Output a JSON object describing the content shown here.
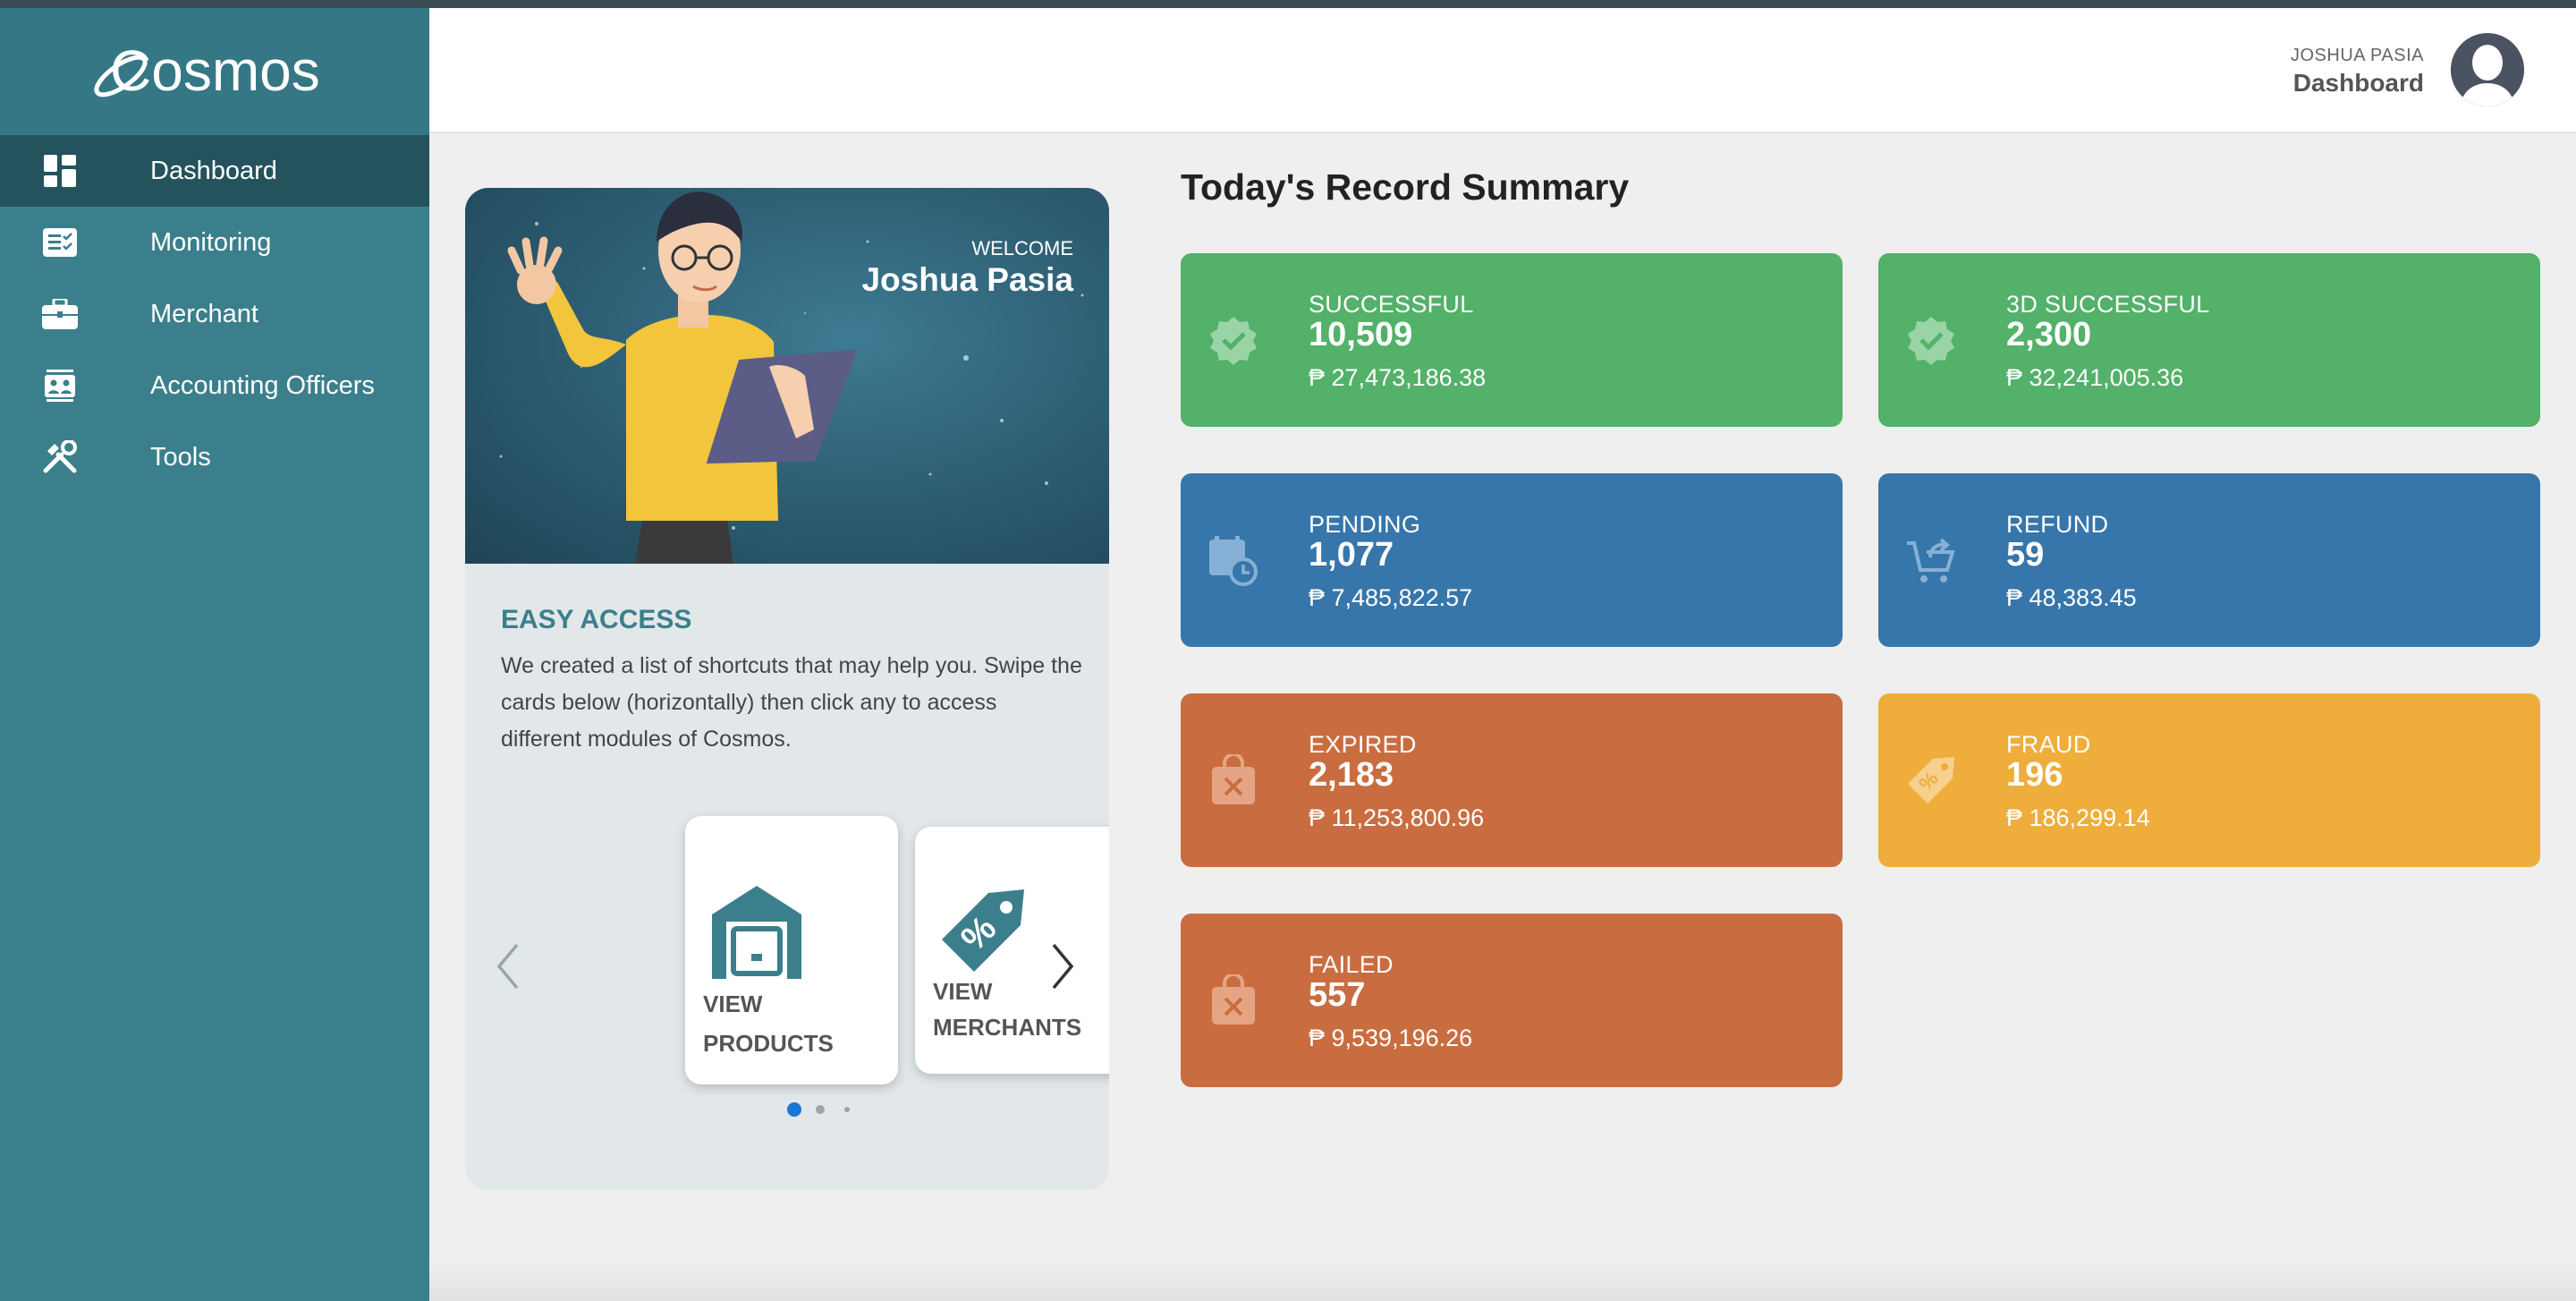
{
  "app": {
    "name": "Cosmos"
  },
  "sidebar": {
    "items": [
      {
        "label": "Dashboard",
        "icon": "dashboard-icon",
        "active": true
      },
      {
        "label": "Monitoring",
        "icon": "monitoring-icon",
        "active": false
      },
      {
        "label": "Merchant",
        "icon": "briefcase-icon",
        "active": false
      },
      {
        "label": "Accounting Officers",
        "icon": "contacts-icon",
        "active": false
      },
      {
        "label": "Tools",
        "icon": "tools-icon",
        "active": false
      }
    ]
  },
  "header": {
    "user_name": "JOSHUA PASIA",
    "page": "Dashboard"
  },
  "welcome": {
    "label": "WELCOME",
    "name": "Joshua Pasia"
  },
  "easy_access": {
    "title": "EASY ACCESS",
    "description": "We created a list of shortcuts that may help you. Swipe the cards below (horizontally) then click any to access different modules of Cosmos.",
    "cards": [
      {
        "line1": "VIEW",
        "line2": "PRODUCTS",
        "icon": "warehouse-icon"
      },
      {
        "line1": "VIEW",
        "line2": "MERCHANTS",
        "icon": "price-tag-icon"
      }
    ]
  },
  "summary": {
    "title": "Today's Record Summary",
    "stats": [
      {
        "label": "SUCCESSFUL",
        "count": "10,509",
        "amount": "₱ 27,473,186.38",
        "color": "#53b169",
        "icon": "verified-badge-icon"
      },
      {
        "label": "3D SUCCESSFUL",
        "count": "2,300",
        "amount": "₱ 32,241,005.36",
        "color": "#53b169",
        "icon": "verified-badge-icon"
      },
      {
        "label": "PENDING",
        "count": "1,077",
        "amount": "₱ 7,485,822.57",
        "color": "#3676aa",
        "icon": "calendar-clock-icon"
      },
      {
        "label": "REFUND",
        "count": "59",
        "amount": "₱ 48,383.45",
        "color": "#3676aa",
        "icon": "cart-return-icon"
      },
      {
        "label": "EXPIRED",
        "count": "2,183",
        "amount": "₱ 11,253,800.96",
        "color": "#c96d40",
        "icon": "bag-x-icon"
      },
      {
        "label": "FRAUD",
        "count": "196",
        "amount": "₱ 186,299.14",
        "color": "#efad3c",
        "icon": "tag-percent-icon"
      },
      {
        "label": "FAILED",
        "count": "557",
        "amount": "₱ 9,539,196.26",
        "color": "#c96d40",
        "icon": "bag-x-icon"
      }
    ]
  }
}
